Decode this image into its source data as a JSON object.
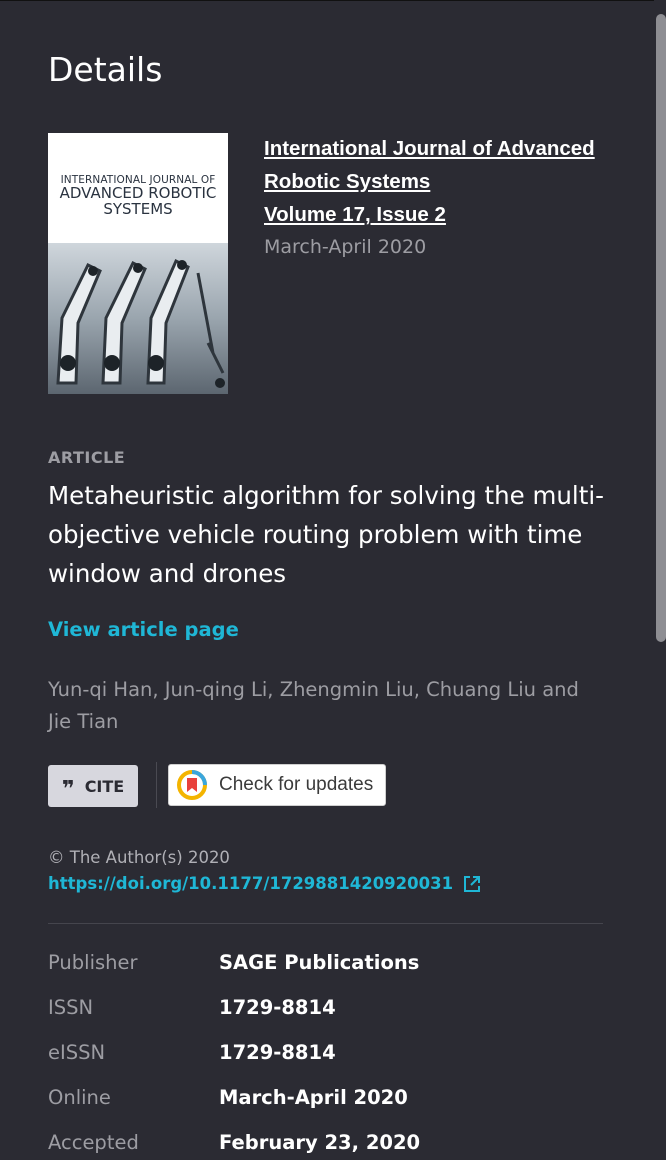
{
  "panel": {
    "title": "Details",
    "journal": {
      "name_line1": "International Journal of Advanced",
      "name_line2": "Robotic Systems",
      "volume_issue": "Volume 17, Issue 2",
      "date": "March-April 2020",
      "cover": {
        "line1": "INTERNATIONAL JOURNAL OF",
        "line2": "ADVANCED ROBOTIC",
        "line3": "SYSTEMS"
      }
    },
    "article": {
      "label": "ARTICLE",
      "title": "Metaheuristic algorithm for solving the multi-objective vehicle routing problem with time window and drones",
      "view_link": "View article page",
      "authors": "Yun-qi Han, Jun-qing Li, Zhengmin Liu, Chuang Liu and Jie Tian"
    },
    "buttons": {
      "cite_label": "CITE",
      "updates_label": "Check for updates"
    },
    "copyright": "© The Author(s) 2020",
    "doi": "https://doi.org/10.1177/1729881420920031",
    "meta": [
      {
        "key": "Publisher",
        "value": "SAGE Publications"
      },
      {
        "key": "ISSN",
        "value": "1729-8814"
      },
      {
        "key": "eISSN",
        "value": "1729-8814"
      },
      {
        "key": "Online",
        "value": "March-April 2020"
      },
      {
        "key": "Accepted",
        "value": "February 23, 2020"
      }
    ]
  },
  "colors": {
    "background": "#2b2b33",
    "accent_link": "#1fb7d6",
    "muted_text": "#9d9da3"
  }
}
